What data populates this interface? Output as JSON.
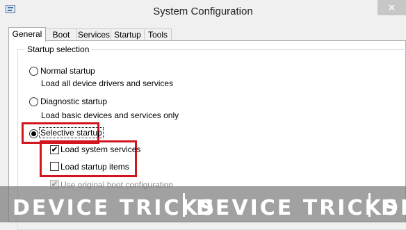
{
  "window": {
    "title": "System Configuration",
    "close_glyph": "✕"
  },
  "tabs": [
    {
      "label": "General",
      "active": true
    },
    {
      "label": "Boot"
    },
    {
      "label": "Services"
    },
    {
      "label": "Startup"
    },
    {
      "label": "Tools"
    }
  ],
  "startup_selection": {
    "group_title": "Startup selection",
    "options": [
      {
        "label": "Normal startup",
        "description": "Load all device drivers and services",
        "selected": false
      },
      {
        "label": "Diagnostic startup",
        "description": "Load basic devices and services only",
        "selected": false
      },
      {
        "label": "Selective startup",
        "selected": true
      }
    ],
    "sub_options": [
      {
        "label": "Load system services",
        "checked": true
      },
      {
        "label": "Load startup items",
        "checked": false
      },
      {
        "label": "Use original boot configuration",
        "checked": true,
        "disabled": true
      }
    ]
  },
  "highlight_color": "#d2141c",
  "watermark": {
    "segments": [
      "DEVICE TRICKS",
      "DEVICE TRICKS",
      "DE"
    ]
  }
}
